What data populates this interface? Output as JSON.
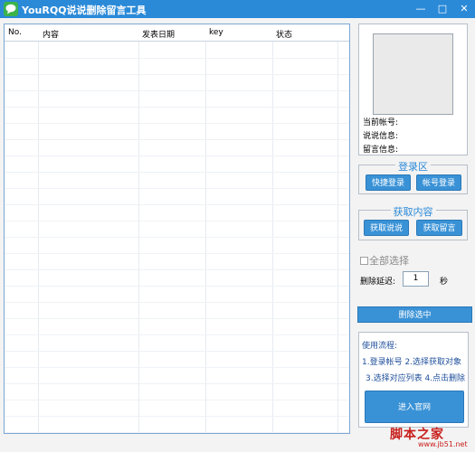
{
  "window": {
    "title": "YouRQQ说说删除留言工具",
    "minimize_label": "—",
    "maximize_label": "□",
    "close_label": "✕"
  },
  "table": {
    "columns": [
      "No.",
      "内容",
      "发表日期",
      "key",
      "状态"
    ],
    "rows": []
  },
  "account_info": {
    "current_account_label": "当前帐号:",
    "shuoshuo_info_label": "说说信息:",
    "message_info_label": "留言信息:"
  },
  "login": {
    "title": "登录区",
    "quick_login": "快捷登录",
    "account_login": "帐号登录"
  },
  "fetch": {
    "title": "获取内容",
    "fetch_shuoshuo": "获取说说",
    "fetch_messages": "获取留言"
  },
  "select_all": {
    "label": "全部选择",
    "checked": false
  },
  "delay": {
    "label": "删除延迟:",
    "value": "1",
    "unit": "秒"
  },
  "delete_selected": "删除选中",
  "usage": {
    "title": "使用流程:",
    "step_line_1": "1.登录帐号  2.选择获取对象",
    "step_line_2": "3.选择对应列表 4.点击删除",
    "official_site": "进入官网"
  },
  "watermark": {
    "text": "脚本之家",
    "url": "www.jb51.net"
  },
  "colors": {
    "title_bar": "#2b8ad8",
    "button": "#3a92d6",
    "group_title": "#2b8ad8",
    "usage_text": "#1f4f9b",
    "watermark": "#c8201d"
  },
  "icons": {
    "app": "chat-bubble-icon",
    "minimize": "minimize-icon",
    "maximize": "maximize-icon",
    "close": "close-icon"
  }
}
